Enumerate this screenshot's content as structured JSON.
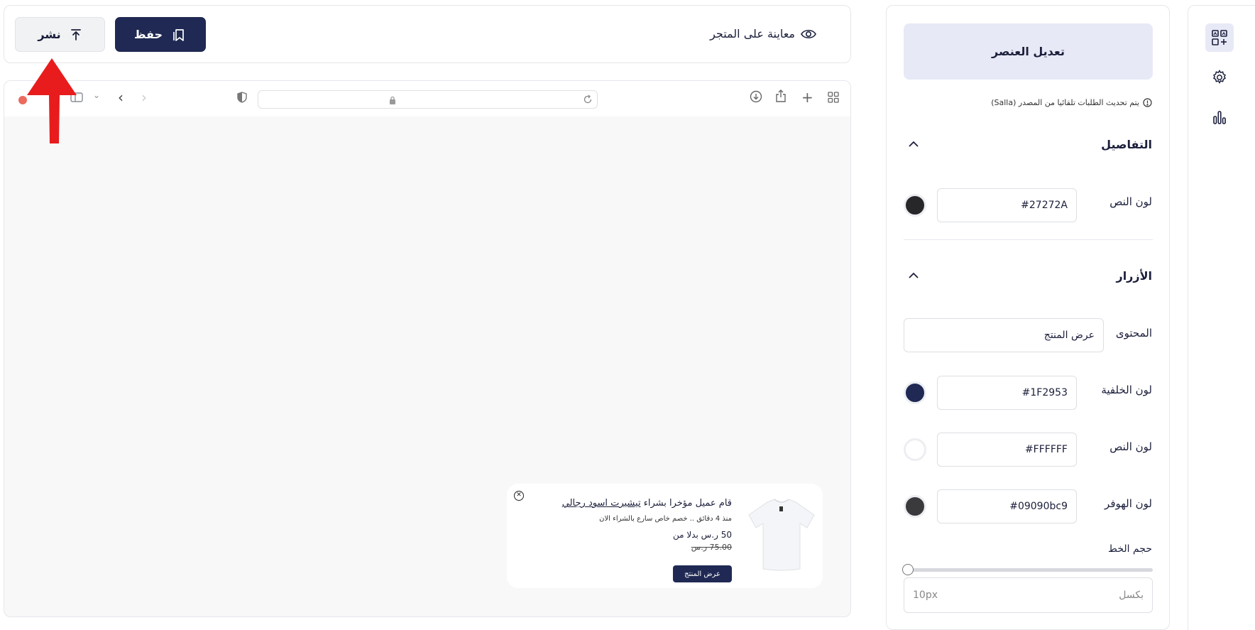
{
  "toolbar": {
    "publish_label": "نشر",
    "save_label": "حفظ",
    "preview_label": "معاينة على المتجر"
  },
  "notification": {
    "title_prefix": "قام عميل مؤخرا بشراء",
    "product_name": "تيشيرت اسود رجالي",
    "subtitle": "منذ 4 دقائق .. خصم خاص سارع بالشراء الان",
    "price_text": "50 ر.س بدلا من",
    "old_price": "75.00 ر.س",
    "button_label": "عرض المنتج"
  },
  "panel": {
    "header": "تعديل العنصر",
    "sync_note": "يتم تحديث الطلبات تلقائيا من المصدر (Salla)",
    "details_section": {
      "title": "التفاصيل",
      "text_color_label": "لون النص",
      "text_color_value": "#27272A",
      "text_color": "#27272A"
    },
    "buttons_section": {
      "title": "الأزرار",
      "content_label": "المحتوى",
      "content_value": "عرض المنتج",
      "bg_label": "لون الخلفية",
      "bg_value": "#1F2953",
      "bg_color": "#1F2953",
      "text_label": "لون النص",
      "text_value": "FFFFFF#",
      "text_color": "#FFFFFF",
      "hover_label": "لون الهوفر",
      "hover_value": "#09090bc9",
      "hover_color": "#3a3a3c",
      "font_size_label": "حجم الخط",
      "font_size_value": "10px",
      "font_size_unit": "بكسل"
    }
  },
  "rail": {
    "items": [
      "elements-icon",
      "gear-icon",
      "chart-icon"
    ]
  }
}
